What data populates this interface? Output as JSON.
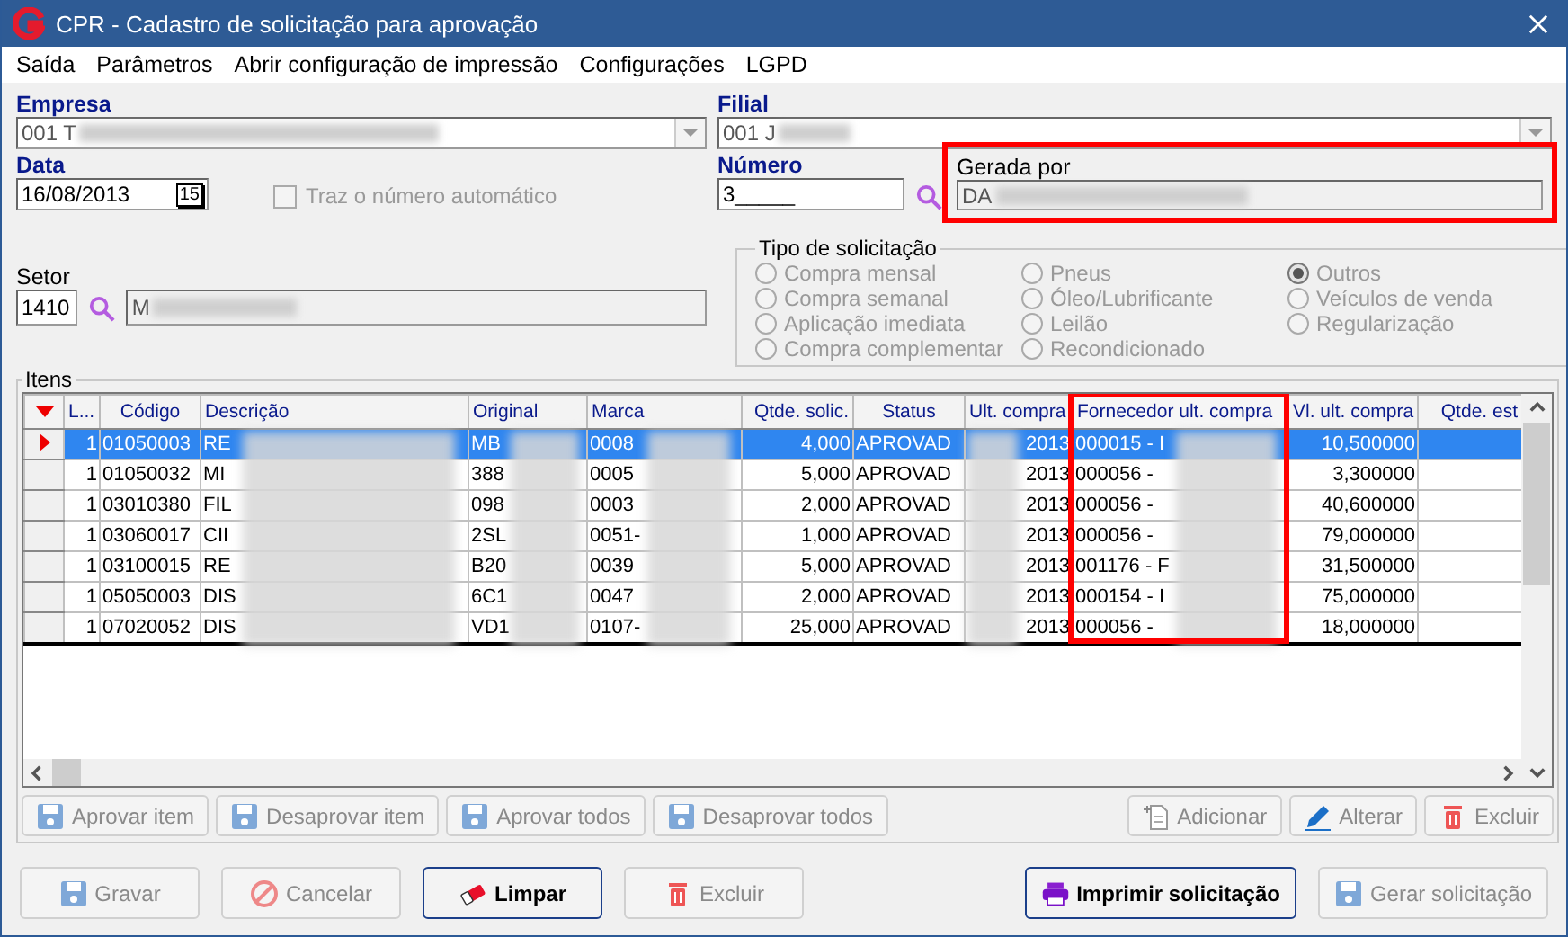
{
  "window": {
    "title": "CPR - Cadastro de solicitação para aprovação"
  },
  "menu": [
    "Saída",
    "Parâmetros",
    "Abrir configuração de impressão",
    "Configurações",
    "LGPD"
  ],
  "empresa": {
    "label": "Empresa",
    "value": "001 T"
  },
  "filial": {
    "label": "Filial",
    "value": "001 J"
  },
  "data": {
    "label": "Data",
    "value": "16/08/2013",
    "calendar_day": "15"
  },
  "auto_number": {
    "label": "Traz o número automático",
    "checked": false,
    "disabled": true
  },
  "numero": {
    "label": "Número",
    "value": "3_____"
  },
  "gerada_por": {
    "label": "Gerada por",
    "value": "DA",
    "highlighted": true
  },
  "setor": {
    "label": "Setor",
    "code": "1410",
    "name": "M"
  },
  "tipo_solicitacao": {
    "title": "Tipo de solicitação",
    "disabled": true,
    "options": [
      {
        "label": "Compra mensal",
        "selected": false
      },
      {
        "label": "Compra semanal",
        "selected": false
      },
      {
        "label": "Aplicação imediata",
        "selected": false
      },
      {
        "label": "Compra complementar",
        "selected": false
      },
      {
        "label": "Pneus",
        "selected": false
      },
      {
        "label": "Óleo/Lubrificante",
        "selected": false
      },
      {
        "label": "Leilão",
        "selected": false
      },
      {
        "label": "Recondicionado",
        "selected": false
      },
      {
        "label": "Outros",
        "selected": true
      },
      {
        "label": "Veículos de venda",
        "selected": false
      },
      {
        "label": "Regularização",
        "selected": false
      }
    ]
  },
  "itens": {
    "title": "Itens",
    "columns": [
      {
        "label": "L...",
        "highlighted": false
      },
      {
        "label": "Código",
        "highlighted": false
      },
      {
        "label": "Descrição",
        "highlighted": false
      },
      {
        "label": "Original",
        "highlighted": false
      },
      {
        "label": "Marca",
        "highlighted": false
      },
      {
        "label": "Qtde. solic.",
        "highlighted": false
      },
      {
        "label": "Status",
        "highlighted": false
      },
      {
        "label": "Ult. compra",
        "highlighted": false
      },
      {
        "label": "Fornecedor ult. compra",
        "highlighted": true
      },
      {
        "label": "Vl. ult. compra",
        "highlighted": false
      },
      {
        "label": "Qtde. est",
        "highlighted": false
      }
    ],
    "rows": [
      {
        "selected": true,
        "cells": [
          "1",
          "01050003",
          "RE",
          "MB",
          "0008",
          "4,000",
          "APROVAD",
          "2013",
          "000015 - I",
          "10,500000",
          ""
        ]
      },
      {
        "selected": false,
        "cells": [
          "1",
          "01050032",
          "MI",
          "388",
          "0005",
          "5,000",
          "APROVAD",
          "2013",
          "000056 -",
          "3,300000",
          ""
        ]
      },
      {
        "selected": false,
        "cells": [
          "1",
          "03010380",
          "FIL",
          "098",
          "0003",
          "2,000",
          "APROVAD",
          "2013",
          "000056 -",
          "40,600000",
          ""
        ]
      },
      {
        "selected": false,
        "cells": [
          "1",
          "03060017",
          "CII",
          "2SL",
          "0051-",
          "1,000",
          "APROVAD",
          "2013",
          "000056 -",
          "79,000000",
          ""
        ]
      },
      {
        "selected": false,
        "cells": [
          "1",
          "03100015",
          "RE",
          "B20",
          "0039",
          "5,000",
          "APROVAD",
          "2013",
          "001176 - F",
          "31,500000",
          ""
        ]
      },
      {
        "selected": false,
        "cells": [
          "1",
          "05050003",
          "DIS",
          "6C1",
          "0047",
          "2,000",
          "APROVAD",
          "2013",
          "000154 - I",
          "75,000000",
          ""
        ]
      },
      {
        "selected": false,
        "cells": [
          "1",
          "07020052",
          "DIS",
          "VD1",
          "0107-",
          "25,000",
          "APROVAD",
          "2013",
          "000056 -",
          "18,000000",
          ""
        ]
      }
    ]
  },
  "item_buttons": [
    {
      "label": "Aprovar item",
      "kind": "save",
      "disabled": true
    },
    {
      "label": "Desaprovar item",
      "kind": "save",
      "disabled": true
    },
    {
      "label": "Aprovar todos",
      "kind": "save",
      "disabled": true
    },
    {
      "label": "Desaprovar todos",
      "kind": "save",
      "disabled": true
    }
  ],
  "grid_buttons": [
    {
      "label": "Adicionar",
      "kind": "add",
      "disabled": true
    },
    {
      "label": "Alterar",
      "kind": "edit",
      "disabled": true
    },
    {
      "label": "Excluir",
      "kind": "delete",
      "disabled": true
    }
  ],
  "bottom_buttons": [
    {
      "label": "Gravar",
      "kind": "save",
      "disabled": true,
      "default": false
    },
    {
      "label": "Cancelar",
      "kind": "cancel",
      "disabled": true,
      "default": false
    },
    {
      "label": "Limpar",
      "kind": "clear",
      "disabled": false,
      "default": true
    },
    {
      "label": "Excluir",
      "kind": "delete",
      "disabled": true,
      "default": false
    }
  ],
  "bottom_right_buttons": [
    {
      "label": "Imprimir solicitação",
      "kind": "print",
      "disabled": false,
      "default": true
    },
    {
      "label": "Gerar solicitação",
      "kind": "save",
      "disabled": true,
      "default": false
    }
  ]
}
